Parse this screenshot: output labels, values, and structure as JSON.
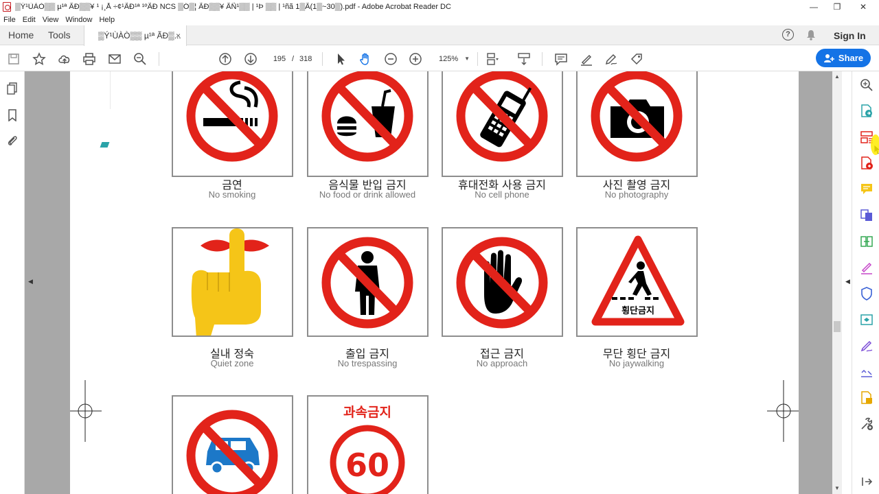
{
  "window": {
    "title": "▒Ý¹ÙÀÒ▒▒ µ¹ª ÃÐ▒▒¥ ¹ ¡¸Å ÷¢¹ÃÐ¹ª ¹ºÃÐ NCS ▒Ó▒¦ ÃÐ▒▒¥ ÃÑ¹▒▒ | ¹Þ ▒▒ | ¹ñã 1▒Ã(1▒~30▒).pdf - Adobe Acrobat Reader DC",
    "minimize": "—",
    "maximize": "❐",
    "close": "✕"
  },
  "menu": [
    "File",
    "Edit",
    "View",
    "Window",
    "Help"
  ],
  "tabs": {
    "home": "Home",
    "tools": "Tools",
    "doc": "▒Ý¹ÙÀÒ▒▒ µ¹ª ÃÐ▒...",
    "doc_close": "×"
  },
  "header": {
    "help": "?",
    "sign_in": "Sign In"
  },
  "toolbar": {
    "current_page": "195",
    "separator": "/",
    "total_pages": "318",
    "zoom": "125%",
    "zoom_caret": "▼",
    "share": "Share"
  },
  "signs": [
    {
      "ko": "금연",
      "en": "No smoking",
      "icon": "no-smoking-icon"
    },
    {
      "ko": "음식물 반입 금지",
      "en": "No food or drink allowed",
      "icon": "no-food-icon"
    },
    {
      "ko": "휴대전화 사용 금지",
      "en": "No cell phone",
      "icon": "no-phone-icon"
    },
    {
      "ko": "사진 촬영 금지",
      "en": "No photography",
      "icon": "no-camera-icon"
    },
    {
      "ko": "실내 정숙",
      "en": "Quiet zone",
      "icon": "quiet-icon"
    },
    {
      "ko": "출입 금지",
      "en": "No trespassing",
      "icon": "no-entry-person-icon"
    },
    {
      "ko": "접근 금지",
      "en": "No approach",
      "icon": "no-approach-hand-icon"
    },
    {
      "ko": "무단 횡단 금지",
      "en": "No jaywalking",
      "icon": "jaywalking-icon"
    },
    {
      "ko": "",
      "en": "",
      "icon": "no-car-icon"
    },
    {
      "ko": "",
      "en": "",
      "icon": "speed-limit-icon"
    }
  ],
  "sign_texts": {
    "crosswalk_label": "횡단금지",
    "speed_title": "과속금지",
    "speed_value": "60"
  },
  "colors": {
    "accent": "#1473e6",
    "prohibition_red": "#e2231a",
    "gutter": "#a8a8a8"
  }
}
